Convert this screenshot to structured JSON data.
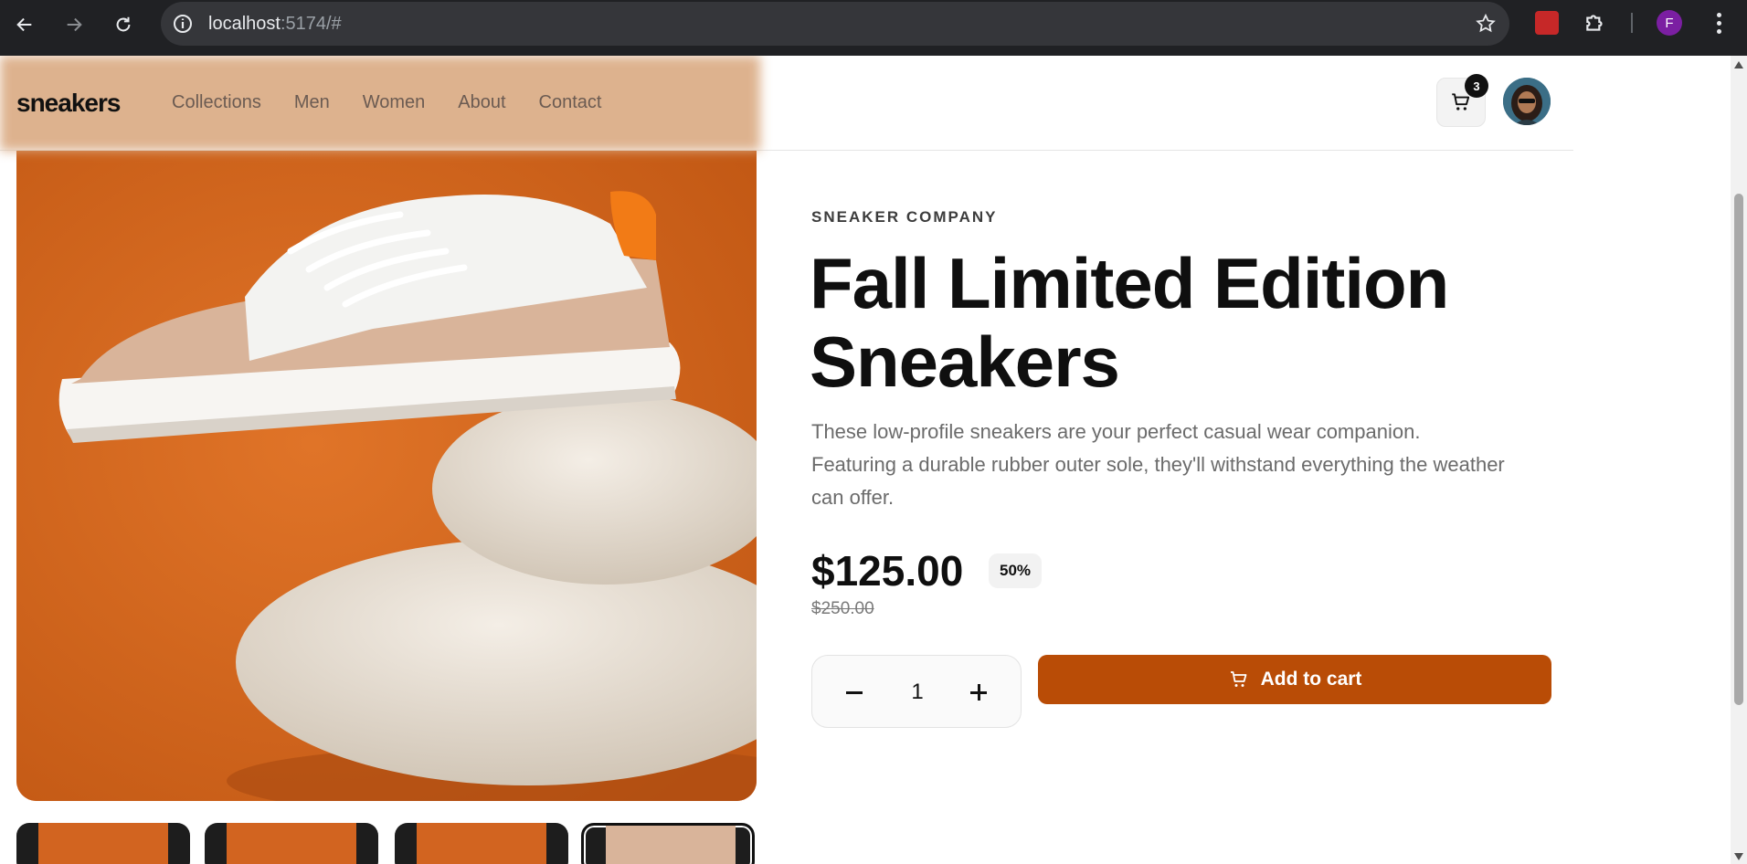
{
  "browser": {
    "url_host": "localhost",
    "url_rest": ":5174/#",
    "profile_initial": "F"
  },
  "header": {
    "logo": "sneakers",
    "nav": [
      "Collections",
      "Men",
      "Women",
      "About",
      "Contact"
    ],
    "cart_count": "3"
  },
  "product": {
    "company": "SNEAKER COMPANY",
    "title": "Fall Limited Edition Sneakers",
    "description": "These low-profile sneakers are your perfect casual wear companion. Featuring a durable rubber outer sole, they'll withstand everything the weather can offer.",
    "price": "$125.00",
    "discount": "50%",
    "old_price": "$250.00",
    "quantity": "1",
    "add_to_cart_label": "Add to cart"
  },
  "colors": {
    "accent": "#b94c06",
    "hero_background": "#d26420"
  }
}
